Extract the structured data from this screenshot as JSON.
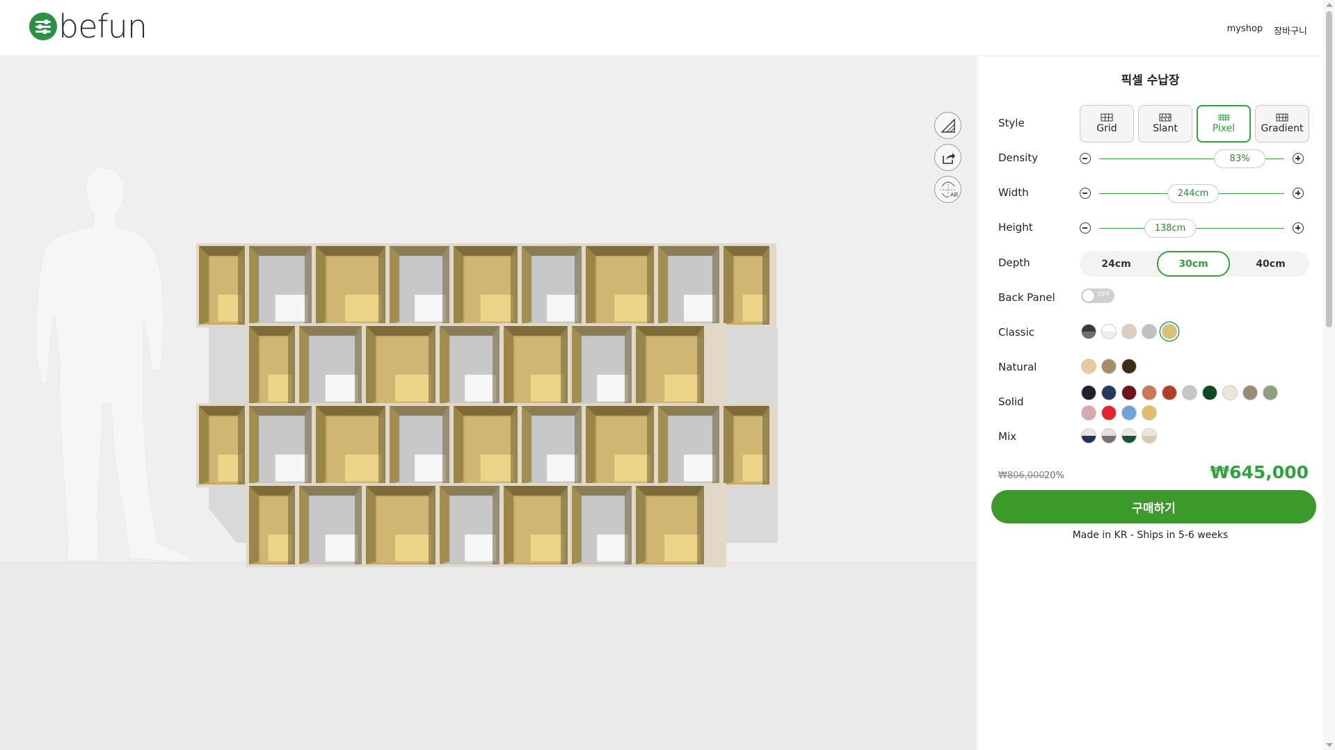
{
  "brand": {
    "name": "befun",
    "accent": "#2c9142"
  },
  "header": {
    "links": [
      "myshop",
      "장바구니"
    ]
  },
  "viewer": {
    "tools": [
      "measure-icon",
      "share-icon",
      "ar-view-icon"
    ],
    "ar_label": "AR"
  },
  "panel": {
    "title": "픽셀 수납장",
    "labels": {
      "style": "Style",
      "density": "Density",
      "width": "Width",
      "height": "Height",
      "depth": "Depth",
      "back_panel": "Back Panel",
      "classic": "Classic",
      "natural": "Natural",
      "solid": "Solid",
      "mix": "Mix"
    },
    "styles": [
      {
        "label": "Grid",
        "active": false
      },
      {
        "label": "Slant",
        "active": false
      },
      {
        "label": "Pixel",
        "active": true
      },
      {
        "label": "Gradient",
        "active": false
      }
    ],
    "density": {
      "value": "83%",
      "level": 0.83
    },
    "width": {
      "value": "244cm",
      "level": 0.5
    },
    "height": {
      "value": "138cm",
      "level": 0.38
    },
    "depth": {
      "options": [
        "24cm",
        "30cm",
        "40cm"
      ],
      "selected": "30cm"
    },
    "back_panel": {
      "state": "OFF"
    },
    "colors": {
      "classic": [
        {
          "c1": "#3a3a3a",
          "c2": "#6f6f6f"
        },
        {
          "c1": "#ffffff",
          "c2": "#f0ede6"
        },
        {
          "c1": "#dcccc2",
          "c2": "#dcccc2"
        },
        {
          "c1": "#c0c0c0",
          "c2": "#c0c0c0"
        },
        {
          "c1": "#d9bf78",
          "c2": "#d9bf78",
          "selected": true
        }
      ],
      "natural": [
        {
          "c1": "#e8c9a0",
          "c2": "#e8c9a0"
        },
        {
          "c1": "#a68d6a",
          "c2": "#a68d6a"
        },
        {
          "c1": "#3e2b14",
          "c2": "#3e2b14"
        }
      ],
      "solid": [
        {
          "c1": "#1f2128",
          "c2": "#1f2128"
        },
        {
          "c1": "#243860",
          "c2": "#243860"
        },
        {
          "c1": "#6c1418",
          "c2": "#6c1418"
        },
        {
          "c1": "#c97a50",
          "c2": "#c97a50"
        },
        {
          "c1": "#b33e2a",
          "c2": "#b33e2a"
        },
        {
          "c1": "#c6c6c6",
          "c2": "#c6c6c6"
        },
        {
          "c1": "#0f4a26",
          "c2": "#0f4a26"
        },
        {
          "c1": "#ebe6dc",
          "c2": "#ebe6dc"
        },
        {
          "c1": "#9a8a78",
          "c2": "#9a8a78"
        },
        {
          "c1": "#8fa07c",
          "c2": "#8fa07c"
        },
        {
          "c1": "#d4aaaa",
          "c2": "#d4aaaa"
        },
        {
          "c1": "#e0262a",
          "c2": "#e0262a"
        },
        {
          "c1": "#6fa4d8",
          "c2": "#6fa4d8"
        },
        {
          "c1": "#e0bd6c",
          "c2": "#e0bd6c"
        }
      ],
      "mix": [
        {
          "c1": "#e8e2da",
          "c2": "#22305a"
        },
        {
          "c1": "#e5e0d8",
          "c2": "#7a6f74"
        },
        {
          "c1": "#ece7df",
          "c2": "#14542c"
        },
        {
          "c1": "#ede6da",
          "c2": "#d8c8b4"
        }
      ]
    },
    "price": {
      "old": "₩806,000",
      "discount": "20%",
      "new": "₩645,000"
    },
    "buy_label": "구매하기",
    "ship_note": "Made in KR - Ships in 5-6 weeks"
  }
}
